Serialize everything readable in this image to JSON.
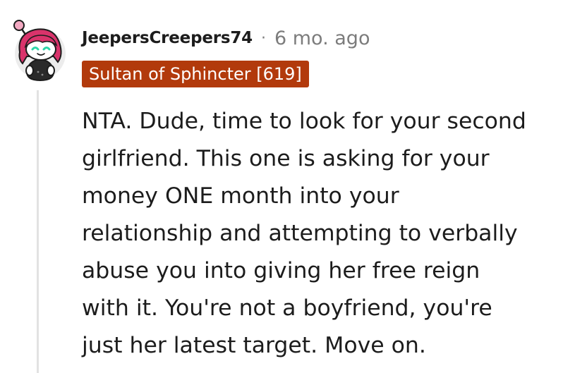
{
  "comment": {
    "username": "JeepersCreepers74",
    "separator": "·",
    "timestamp": "6 mo. ago",
    "flair": "Sultan of Sphincter [619]",
    "body_lines": [
      "NTA. Dude, time to look for your second",
      "girlfriend. This one is asking for your",
      "money ONE month into your",
      "relationship and attempting to verbally",
      "abuse you into giving her free reign",
      "with it. You're not a boyfriend, you're",
      "just her latest target. Move on."
    ]
  },
  "colors": {
    "flair_background": "#b23a0c",
    "avatar_hair": "#d9336b",
    "avatar_eyes": "#2bd6a8",
    "thread_line": "#e2e2e2",
    "meta_gray": "#7c7c7c"
  },
  "icons": {
    "avatar": "snoo-avatar-pink-hair"
  }
}
